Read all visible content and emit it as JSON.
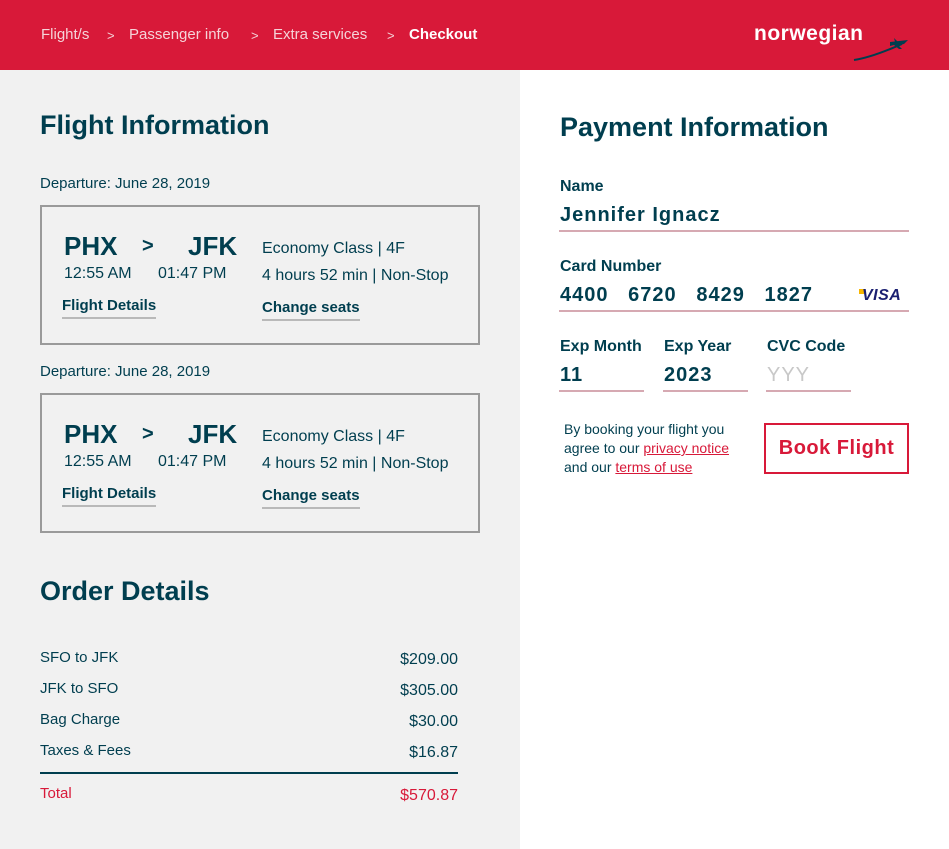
{
  "breadcrumbs": [
    {
      "label": "Flight/s"
    },
    {
      "label": "Passenger info"
    },
    {
      "label": "Extra services"
    },
    {
      "label": "Checkout"
    }
  ],
  "breadcrumb_separator": ">",
  "logo_text": "norwegian",
  "flight_info": {
    "title": "Flight Information",
    "flights": [
      {
        "departure_label": "Departure: June 28, 2019",
        "from": "PHX",
        "arrow": ">",
        "to": "JFK",
        "depart_time": "12:55 AM",
        "arrive_time": "01:47 PM",
        "class_seat": "Economy Class | 4F",
        "duration": "4 hours 52 min | Non-Stop",
        "details_link": "Flight Details",
        "seats_link": "Change seats"
      },
      {
        "departure_label": "Departure: June 28, 2019",
        "from": "PHX",
        "arrow": ">",
        "to": "JFK",
        "depart_time": "12:55 AM",
        "arrive_time": "01:47 PM",
        "class_seat": "Economy Class | 4F",
        "duration": "4 hours 52 min | Non-Stop",
        "details_link": "Flight Details",
        "seats_link": "Change seats"
      }
    ]
  },
  "order": {
    "title": "Order Details",
    "items": [
      {
        "label": "SFO to JFK",
        "amount": "$209.00"
      },
      {
        "label": "JFK to SFO",
        "amount": "$305.00"
      },
      {
        "label": "Bag Charge",
        "amount": "$30.00"
      },
      {
        "label": "Taxes & Fees",
        "amount": "$16.87"
      }
    ],
    "total_label": "Total",
    "total_amount": "$570.87"
  },
  "payment": {
    "title": "Payment Information",
    "name_label": "Name",
    "name_value": "Jennifer Ignacz",
    "card_label": "Card Number",
    "card_value": "4400   6720   8429   1827",
    "card_brand": "VISA",
    "exp_month_label": "Exp Month",
    "exp_month_value": "11",
    "exp_year_label": "Exp Year",
    "exp_year_value": "2023",
    "cvc_label": "CVC Code",
    "cvc_placeholder": "YYY",
    "terms_prefix": "By booking your flight you agree to our ",
    "privacy_link": "privacy notice",
    "terms_mid": " and our ",
    "terms_link": "terms of use",
    "book_button": "Book Flight"
  },
  "colors": {
    "brand_red": "#d81939",
    "navy": "#003e4f",
    "panel_gray": "#f1f1f1"
  }
}
